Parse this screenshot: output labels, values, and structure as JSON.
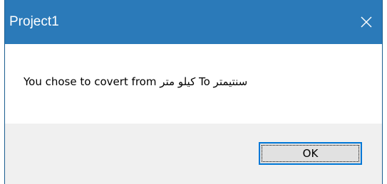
{
  "window": {
    "title": "Project1",
    "close_icon": "close-x-icon"
  },
  "message": {
    "text": "You chose to covert from كيلو متر To سنتيمتر"
  },
  "buttons": {
    "ok_label": "OK"
  },
  "colors": {
    "titlebar": "#2b7ab9",
    "title_text": "#ffffff",
    "content_bg": "#ffffff",
    "footer_bg": "#f0f0f0",
    "button_bg": "#e1e1e1",
    "button_focus_border": "#0078d7"
  }
}
